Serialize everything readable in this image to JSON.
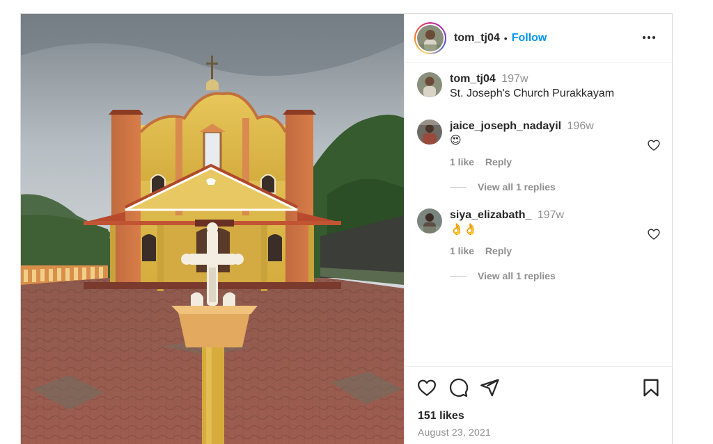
{
  "post": {
    "author": "tom_tj04",
    "separator": "•",
    "follow_label": "Follow",
    "caption": {
      "user": "tom_tj04",
      "time": "197w",
      "text": "St. Joseph's Church Purakkayam"
    },
    "comments": [
      {
        "user": "jaice_joseph_nadayil",
        "time": "196w",
        "text": "😍",
        "likes": "1 like",
        "reply_label": "Reply",
        "view_replies": "View all 1 replies"
      },
      {
        "user": "siya_elizabath_",
        "time": "197w",
        "text": "👌👌",
        "likes": "1 like",
        "reply_label": "Reply",
        "view_replies": "View all 1 replies"
      }
    ],
    "likes_count": "151 likes",
    "date": "August 23, 2021"
  },
  "icons": {
    "more": "more-options-icon",
    "like": "heart-icon",
    "comment": "comment-bubble-icon",
    "share": "paper-plane-icon",
    "save": "bookmark-icon"
  },
  "colors": {
    "accent": "#0095f6",
    "text": "#262626",
    "muted": "#8e8e8e",
    "border": "#dbdbdb"
  }
}
